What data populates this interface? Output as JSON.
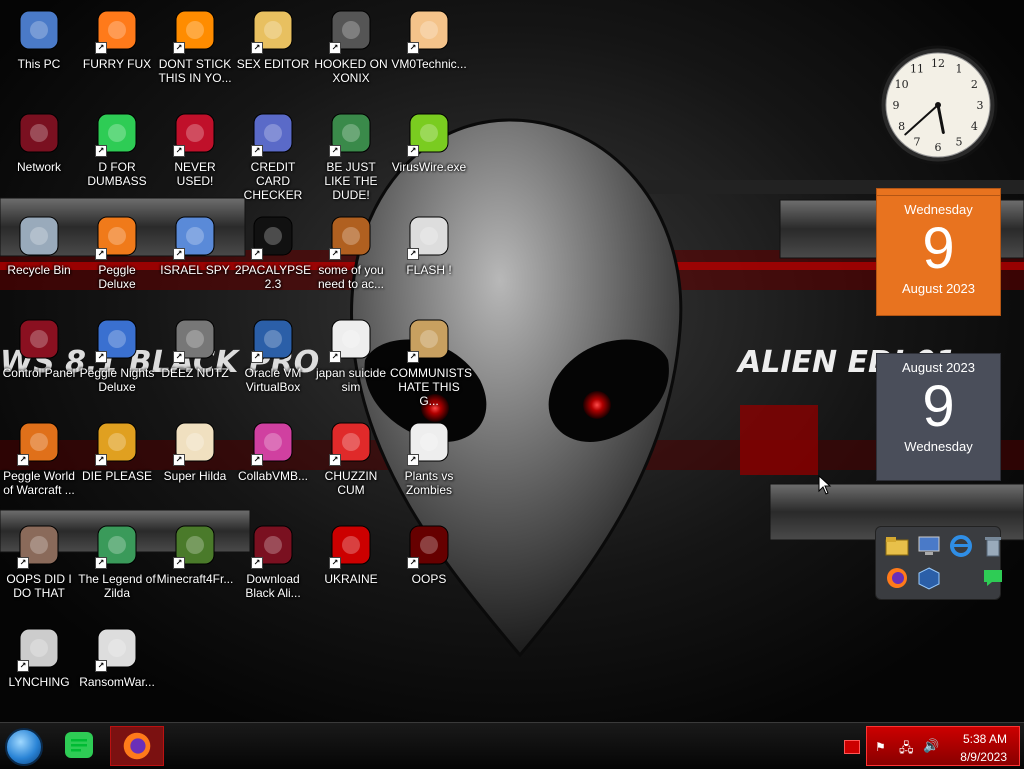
{
  "desktop": {
    "icons": [
      {
        "label": "This PC",
        "icon": "computer-icon"
      },
      {
        "label": "FURRY FUX",
        "icon": "firefox-icon"
      },
      {
        "label": "DONT STICK THIS IN YO...",
        "icon": "vlc-cone-icon"
      },
      {
        "label": "SEX EDITOR",
        "icon": "hxd-editor-icon"
      },
      {
        "label": "HOOKED ON XONIX",
        "icon": "xonix-game-icon"
      },
      {
        "label": "VM0Technic...",
        "icon": "doctor-person-icon"
      },
      {
        "label": "Network",
        "icon": "alien-orb-icon"
      },
      {
        "label": "D FOR DUMBASS",
        "icon": "discord-chat-icon"
      },
      {
        "label": "NEVER USED!",
        "icon": "dev-cpp-icon"
      },
      {
        "label": "CREDIT CARD CHECKER",
        "icon": "credit-card-icon"
      },
      {
        "label": "BE JUST LIKE THE DUDE!",
        "icon": "gnome-santa-icon"
      },
      {
        "label": "VirusWire.exe",
        "icon": "limewire-icon"
      },
      {
        "label": "Recycle Bin",
        "icon": "trash-bin-icon"
      },
      {
        "label": "Peggle Deluxe",
        "icon": "peggle-icon"
      },
      {
        "label": "ISRAEL SPY",
        "icon": "network-spy-icon"
      },
      {
        "label": "2PACALYPSE 2.3",
        "icon": "terminal-icon"
      },
      {
        "label": "some of you need to ac...",
        "icon": "beaver-icon"
      },
      {
        "label": "FLASH !",
        "icon": "flash-file-icon"
      },
      {
        "label": "Control Panel",
        "icon": "control-panel-icon"
      },
      {
        "label": "Peggle Nights Deluxe",
        "icon": "peggle-nights-icon"
      },
      {
        "label": "DEEZ NUTZ",
        "icon": "window-stack-icon"
      },
      {
        "label": "Oracle VM VirtualBox",
        "icon": "virtualbox-icon"
      },
      {
        "label": "japan suicide sim",
        "icon": "game-file-icon"
      },
      {
        "label": "COMMUNISTS HATE THIS G...",
        "icon": "money-bag-icon"
      },
      {
        "label": "Peggle World of Warcraft ...",
        "icon": "peggle-wow-icon"
      },
      {
        "label": "DIE PLEASE",
        "icon": "director-icon"
      },
      {
        "label": "Super Hilda",
        "icon": "pixel-art-icon"
      },
      {
        "label": "CollabVMB...",
        "icon": "collabvm-icon"
      },
      {
        "label": "CHUZZIN CUM",
        "icon": "chuzzle-icon"
      },
      {
        "label": "Plants vs Zombies",
        "icon": "plant-icon"
      },
      {
        "label": "OOPS DID I DO THAT",
        "icon": "portrait-icon"
      },
      {
        "label": "The Legend of Zilda",
        "icon": "pixel-hero-icon"
      },
      {
        "label": "Minecraft4Fr...",
        "icon": "grass-block-icon"
      },
      {
        "label": "Download Black Ali...",
        "icon": "alien-orb-icon"
      },
      {
        "label": "UKRAINE",
        "icon": "radiation-icon"
      },
      {
        "label": "OOPS",
        "icon": "media-device-icon"
      },
      {
        "label": "LYNCHING",
        "icon": "knot-icon"
      },
      {
        "label": "RansomWar...",
        "icon": "skull-icon"
      }
    ]
  },
  "wallpaper": {
    "banner_left": "WS 8.1 BLACK PRO",
    "banner_right": "ALIEN EDI 01"
  },
  "gadgets": {
    "clock": {
      "hour": 5,
      "minute": 38
    },
    "calendar_orange": {
      "weekday": "Wednesday",
      "day": "9",
      "month_year": "August 2023"
    },
    "calendar_gray": {
      "month_year": "August 2023",
      "day": "9",
      "weekday": "Wednesday"
    },
    "launcher": {
      "items": [
        "folder-icon",
        "computer-icon",
        "ie-icon",
        "trash-bin-icon",
        "firefox-icon",
        "virtualbox-icon",
        "",
        "discord-chat-icon"
      ]
    }
  },
  "taskbar": {
    "pinned": [
      "start-orb-icon",
      "discord-chat-icon",
      "firefox-icon"
    ],
    "tray": {
      "time": "5:38 AM",
      "date": "8/9/2023"
    }
  },
  "colors": {
    "accent_red": "#cc0000",
    "calendar_orange": "#e8731f"
  }
}
